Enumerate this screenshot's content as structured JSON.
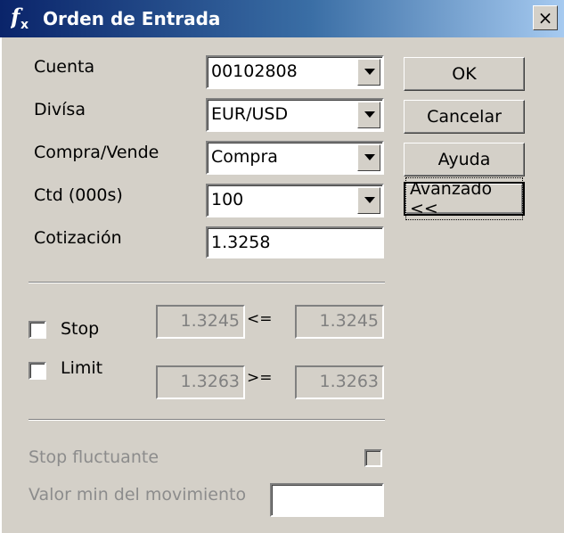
{
  "window": {
    "title": "Orden de Entrada",
    "close_glyph": "×"
  },
  "form": {
    "cuenta": {
      "label": "Cuenta",
      "value": "00102808"
    },
    "divisa": {
      "label": "Divísa",
      "value": "EUR/USD"
    },
    "compra_vende": {
      "label": "Compra/Vende",
      "value": "Compra"
    },
    "ctd": {
      "label": "Ctd (000s)",
      "value": "100"
    },
    "cotizacion": {
      "label": "Cotización",
      "value": "1.3258"
    }
  },
  "buttons": {
    "ok": "OK",
    "cancelar": "Cancelar",
    "ayuda": "Ayuda",
    "avanzado": "Avanzado <<"
  },
  "stop": {
    "label": "Stop",
    "checked": false,
    "value_left": "1.3245",
    "operator": "<=",
    "value_right": "1.3245"
  },
  "limit": {
    "label": "Limit",
    "checked": false,
    "value_left": "1.3263",
    "operator": ">=",
    "value_right": "1.3263"
  },
  "advanced": {
    "stop_fluctuante_label": "Stop fluctuante",
    "stop_fluctuante_checked": false,
    "valor_min_label": "Valor min del movimiento",
    "valor_min_value": ""
  },
  "icons": {
    "title_icon": "function-fx-icon",
    "dropdown": "chevron-down-icon"
  },
  "colors": {
    "title_start": "#0a246a",
    "title_end": "#a6caf0",
    "face": "#d4d0c8",
    "disabled_text": "#8c8c8c"
  }
}
